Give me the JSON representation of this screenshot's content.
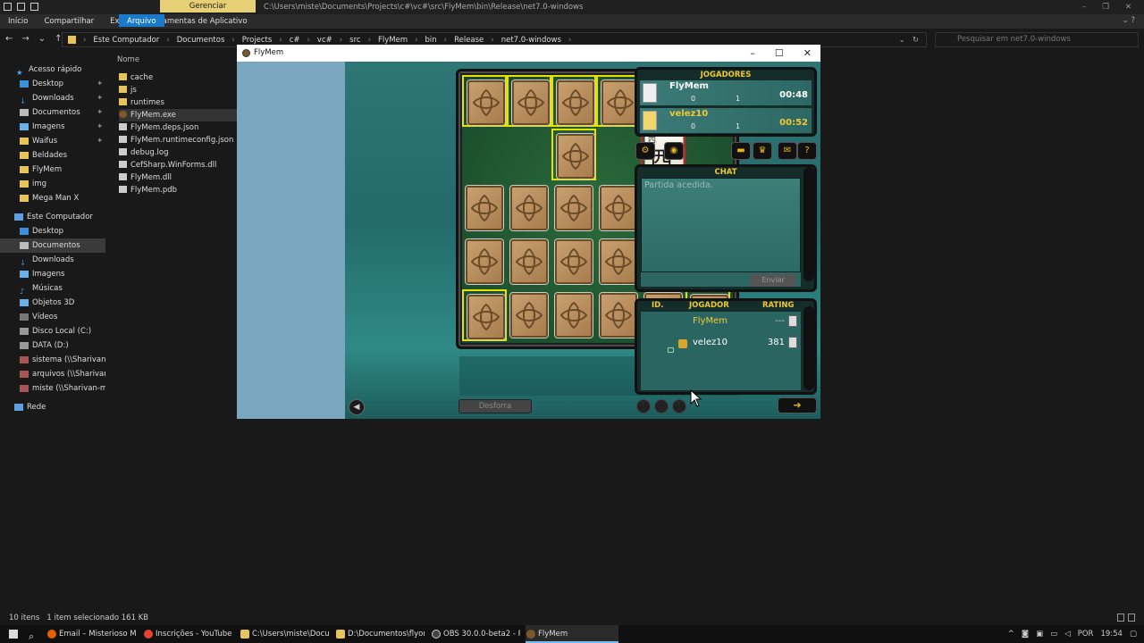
{
  "explorer": {
    "manage_tab": "Gerenciar",
    "path_title": "C:\\Users\\miste\\Documents\\Projects\\c#\\vc#\\src\\FlyMem\\bin\\Release\\net7.0-windows",
    "ribbon": [
      "Arquivo",
      "Início",
      "Compartilhar",
      "Exibir",
      "Ferramentas de Aplicativo"
    ],
    "address": [
      "Este Computador",
      "Documentos",
      "Projects",
      "c#",
      "vc#",
      "src",
      "FlyMem",
      "bin",
      "Release",
      "net7.0-windows"
    ],
    "search_placeholder": "Pesquisar em net7.0-windows",
    "column_name": "Nome",
    "nav": [
      {
        "label": "Acesso rápido",
        "icon": "star-icon"
      },
      {
        "label": "Desktop",
        "icon": "desktop-icon"
      },
      {
        "label": "Downloads",
        "icon": "download-icon"
      },
      {
        "label": "Documentos",
        "icon": "document-icon"
      },
      {
        "label": "Imagens",
        "icon": "image-icon"
      },
      {
        "label": "Waifus",
        "icon": "folder-icon"
      },
      {
        "label": "Beldades",
        "icon": "folder-icon"
      },
      {
        "label": "FlyMem",
        "icon": "folder-icon"
      },
      {
        "label": "img",
        "icon": "folder-icon"
      },
      {
        "label": "Mega Man X",
        "icon": "folder-icon"
      },
      {
        "label": "Este Computador",
        "icon": "computer-icon"
      },
      {
        "label": "Desktop",
        "icon": "desktop-icon"
      },
      {
        "label": "Documentos",
        "icon": "document-icon"
      },
      {
        "label": "Downloads",
        "icon": "download-icon"
      },
      {
        "label": "Imagens",
        "icon": "image-icon"
      },
      {
        "label": "Músicas",
        "icon": "music-icon"
      },
      {
        "label": "Objetos 3D",
        "icon": "cube-icon"
      },
      {
        "label": "Vídeos",
        "icon": "video-icon"
      },
      {
        "label": "Disco Local (C:)",
        "icon": "drive-icon"
      },
      {
        "label": "DATA (D:)",
        "icon": "drive-icon"
      },
      {
        "label": "sistema (\\\\Sharivan-ms",
        "icon": "network-drive-icon"
      },
      {
        "label": "arquivos (\\\\Sharivan-m",
        "icon": "network-drive-icon"
      },
      {
        "label": "miste (\\\\Sharivan-msi\\s",
        "icon": "network-drive-icon"
      },
      {
        "label": "Rede",
        "icon": "network-icon"
      }
    ],
    "files": [
      "cache",
      "js",
      "runtimes",
      "FlyMem.exe",
      "FlyMem.deps.json",
      "FlyMem.runtimeconfig.json",
      "debug.log",
      "CefSharp.WinForms.dll",
      "FlyMem.dll",
      "FlyMem.pdb"
    ],
    "status_count": "10 itens",
    "status_selected": "1 item selecionado  161 KB"
  },
  "game": {
    "window_title": "FlyMem",
    "tile_char": "西",
    "tile_num": "四",
    "players_title": "JOGADORES",
    "players": [
      {
        "name": "FlyMem",
        "score1": "0",
        "score2": "1",
        "time": "00:48",
        "color": "#ffffff"
      },
      {
        "name": "velez10",
        "score1": "0",
        "score2": "1",
        "time": "00:52",
        "color": "#f0c830"
      }
    ],
    "chat_title": "CHAT",
    "chat_message": "Partida acedida.",
    "send_label": "Enviar",
    "ranking_headers": {
      "id": "ID.",
      "player": "JOGADOR",
      "rating": "RATING"
    },
    "ranking": [
      {
        "name": "FlyMem",
        "rating": "---",
        "color": "#f0c830"
      },
      {
        "name": "velez10",
        "rating": "381",
        "color": "#ffffff"
      }
    ],
    "forfeit_label": "Desforra"
  },
  "taskbar": {
    "items": [
      "Email – Misterioso M...",
      "Inscrições - YouTube ...",
      "C:\\Users\\miste\\Docu...",
      "D:\\Documentos\\flyor...",
      "OBS 30.0.0-beta2 - Pe...",
      "FlyMem"
    ],
    "lang": "POR",
    "time": "19:54"
  }
}
